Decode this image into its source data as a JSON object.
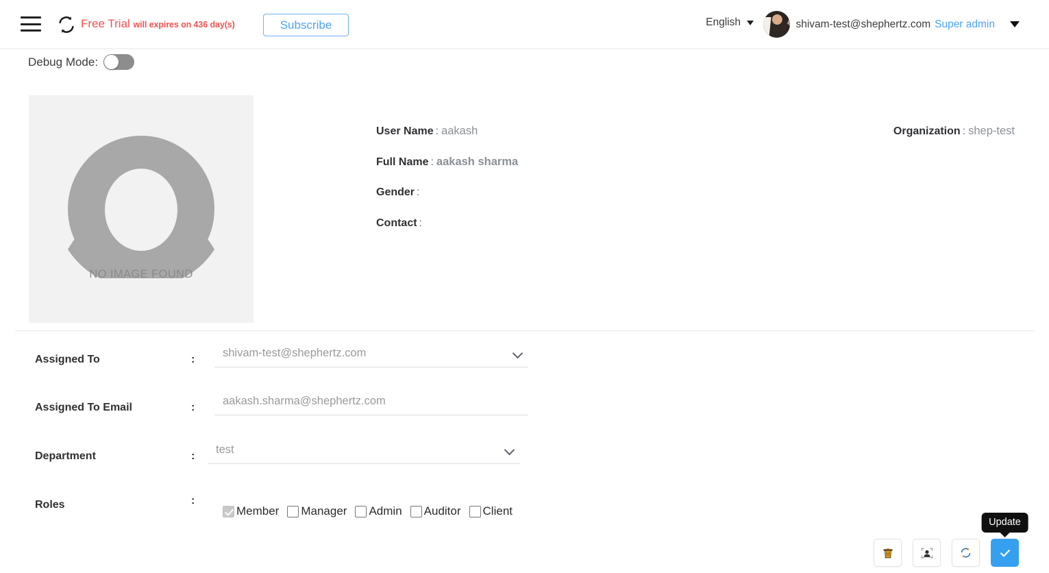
{
  "header": {
    "menu_icon": "hamburger-menu-icon",
    "logo_icon": "sync-logo-icon",
    "trial_prefix": "Free Trial",
    "trial_suffix": "will expires on 436 day(s)",
    "subscribe_label": "Subscribe",
    "language": "English",
    "language_caret_icon": "chevron-down-icon",
    "user_email": "shivam-test@shephertz.com",
    "user_role": "Super admin",
    "user_caret_icon": "chevron-down-icon",
    "avatar_icon": "user-avatar-photo"
  },
  "debug": {
    "label": "Debug Mode:",
    "enabled": false
  },
  "profile": {
    "photo_placeholder_text": "NO IMAGE FOUND",
    "photo_placeholder_icon": "user-silhouette-icon",
    "fields": [
      {
        "label": "User Name",
        "colon": ":",
        "value": "aakash",
        "bold": false
      },
      {
        "label": "Full Name",
        "colon": ":",
        "value": "aakash sharma",
        "bold": true
      },
      {
        "label": "Gender",
        "colon": ":",
        "value": "",
        "bold": false
      },
      {
        "label": "Contact",
        "colon": ":",
        "value": "",
        "bold": false
      }
    ],
    "organization": {
      "label": "Organization",
      "colon": ":",
      "value": "shep-test"
    }
  },
  "form": {
    "assigned_to": {
      "label": "Assigned To",
      "colon": ":",
      "value": "shivam-test@shephertz.com",
      "type": "select",
      "caret_icon": "chevron-down-icon"
    },
    "assigned_to_email": {
      "label": "Assigned To Email",
      "colon": ":",
      "value": "aakash.sharma@shephertz.com",
      "type": "text"
    },
    "department": {
      "label": "Department",
      "colon": ":",
      "value": "test",
      "type": "select",
      "caret_icon": "chevron-down-icon"
    },
    "roles": {
      "label": "Roles",
      "colon": ":",
      "options": [
        {
          "label": "Member",
          "checked": true,
          "disabled": true
        },
        {
          "label": "Manager",
          "checked": false,
          "disabled": false
        },
        {
          "label": "Admin",
          "checked": false,
          "disabled": false
        },
        {
          "label": "Auditor",
          "checked": false,
          "disabled": false
        },
        {
          "label": "Client",
          "checked": false,
          "disabled": false
        }
      ]
    }
  },
  "actions": {
    "delete_icon": "trash-icon",
    "identify_icon": "user-focus-icon",
    "refresh_icon": "refresh-icon",
    "update_icon": "check-icon",
    "update_tooltip": "Update"
  },
  "colors": {
    "accent_blue": "#36a0f0",
    "link_blue": "#4da3f7",
    "trial_red": "#ef5350",
    "tooltip_bg": "#101010",
    "placeholder_grey": "#f2f2f2",
    "silhouette_grey": "#a8a8a8"
  }
}
